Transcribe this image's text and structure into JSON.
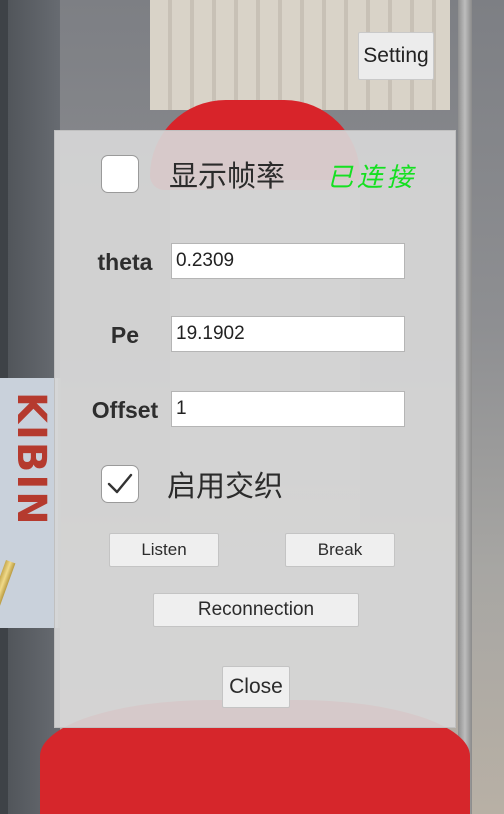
{
  "header": {
    "setting_label": "Setting"
  },
  "panel": {
    "show_fps": {
      "label": "显示帧率",
      "checked": false
    },
    "status_text": "已连接",
    "status_color": "#14e020",
    "fields": [
      {
        "label": "theta",
        "value": "0.2309"
      },
      {
        "label": "Pe",
        "value": "19.1902"
      },
      {
        "label": "Offset",
        "value": "1"
      }
    ],
    "enable_interleave": {
      "label": "启用交织",
      "checked": true
    },
    "buttons": {
      "listen": "Listen",
      "break": "Break",
      "reconnection": "Reconnection",
      "close": "Close"
    }
  },
  "background": {
    "sign_text": "KIBIN"
  }
}
